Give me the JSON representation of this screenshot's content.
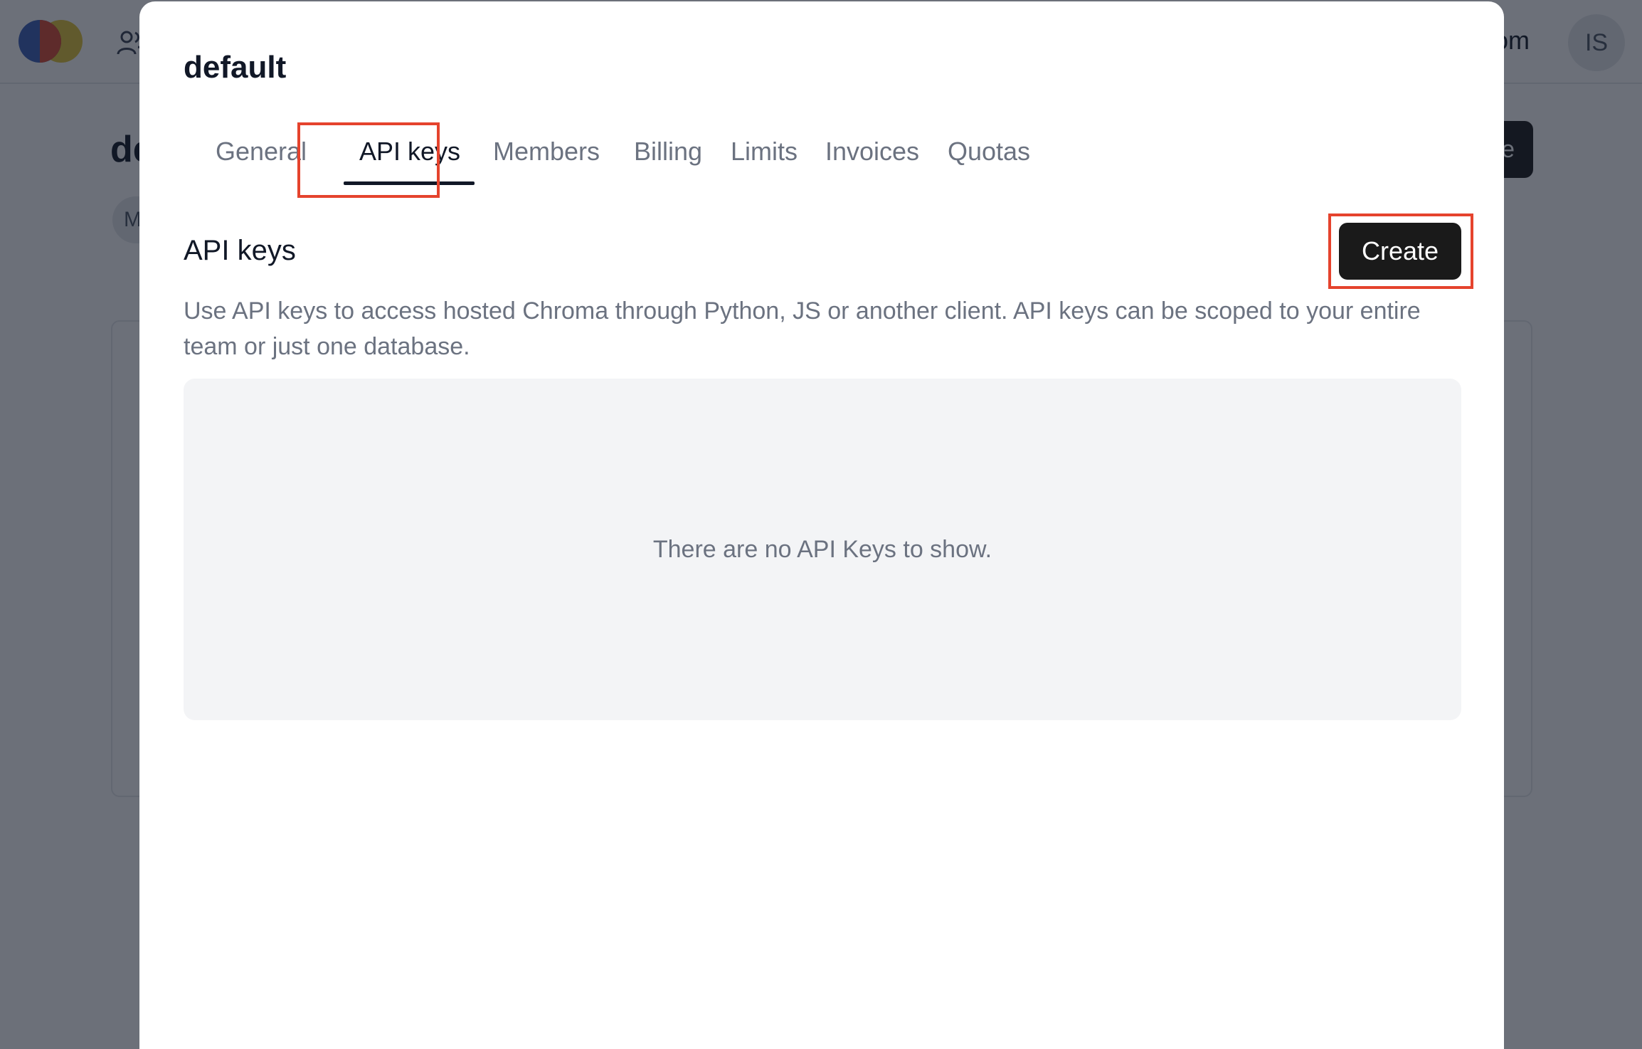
{
  "background": {
    "header": {
      "right_text": "om",
      "avatar_initials": "IS"
    },
    "page_title_fragment": "de",
    "action_button_fragment": "e",
    "chip_fragment": "M"
  },
  "modal": {
    "title": "default",
    "tabs": [
      {
        "label": "General",
        "active": false
      },
      {
        "label": "API keys",
        "active": true
      },
      {
        "label": "Members",
        "active": false
      },
      {
        "label": "Billing",
        "active": false
      },
      {
        "label": "Limits",
        "active": false
      },
      {
        "label": "Invoices",
        "active": false
      },
      {
        "label": "Quotas",
        "active": false
      }
    ],
    "section": {
      "title": "API keys",
      "create_label": "Create",
      "description": "Use API keys to access hosted Chroma through Python, JS or another client. API keys can be scoped to your entire team or just one database.",
      "empty_message": "There are no API Keys to show."
    }
  },
  "colors": {
    "highlight": "#e5432d",
    "primary_button": "#1a1a1a",
    "active_tab": "#111827",
    "inactive_tab": "#6b7280",
    "empty_panel": "#f3f4f6"
  }
}
